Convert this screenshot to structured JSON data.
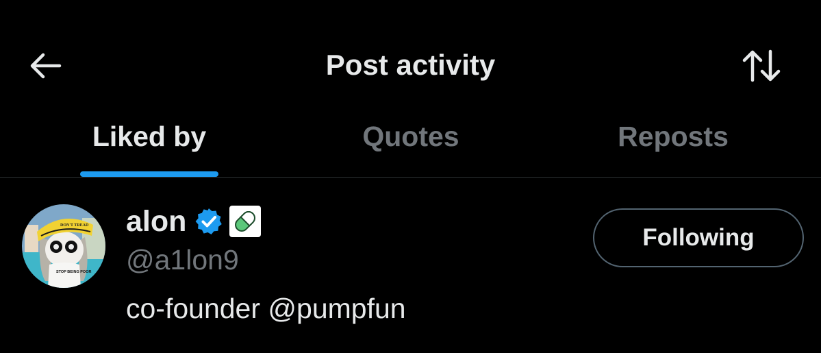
{
  "header": {
    "title": "Post activity",
    "back_icon": "arrow-left-icon",
    "sort_icon": "sort-arrows-icon"
  },
  "tabs": [
    {
      "label": "Liked by",
      "active": true
    },
    {
      "label": "Quotes",
      "active": false
    },
    {
      "label": "Reposts",
      "active": false
    }
  ],
  "colors": {
    "background": "#000000",
    "text_primary": "#e7e9ea",
    "text_secondary": "#71767b",
    "accent": "#1d9bf0",
    "divider": "#2f3336"
  },
  "users": [
    {
      "display_name": "alon",
      "handle": "@a1lon9",
      "bio": "co-founder @pumpfun",
      "verified_icon": "verified-badge-icon",
      "badge_icon": "pill-icon",
      "avatar_caption": "DON'T TREAD",
      "shirt_text": "STOP BEING POOR",
      "follow_label": "Following"
    }
  ]
}
